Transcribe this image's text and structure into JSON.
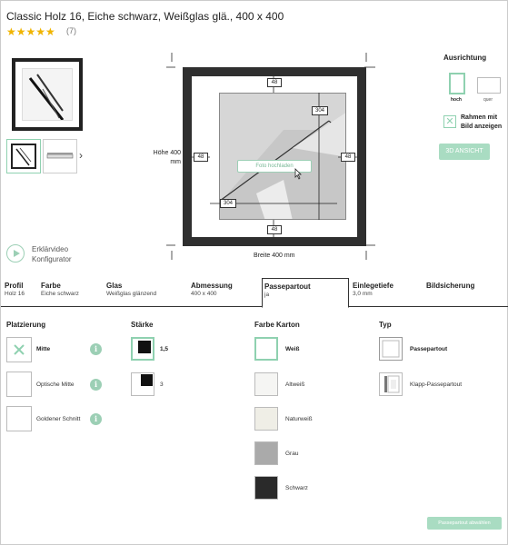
{
  "product": {
    "title": "Classic Holz 16, Eiche schwarz, Weißglas glä., 400 x 400",
    "stars": "★★★★★",
    "rating_count": "(7)"
  },
  "thumbnails": {
    "next": "›"
  },
  "video": {
    "label_line1": "Erklärvideo",
    "label_line2": "Konfigurator"
  },
  "preview": {
    "upload_label": "Foto hochladen",
    "dim_top": "48",
    "dim_bottom": "48",
    "dim_left": "48",
    "dim_right": "48",
    "dim_inner_h": "304",
    "dim_inner_w": "304",
    "height_label_1": "Höhe 400",
    "height_label_2": "mm",
    "width_label": "Breite 400 mm"
  },
  "orientation": {
    "title": "Ausrichtung",
    "hoch": "hoch",
    "quer": "quer",
    "selected": "hoch"
  },
  "show_frame_image": {
    "label": "Rahmen mit Bild anzeigen",
    "checked": true
  },
  "btn_3d": "3D ANSICHT",
  "tabs": [
    {
      "title": "Profil",
      "value": "Holz 16"
    },
    {
      "title": "Farbe",
      "value": "Eiche schwarz"
    },
    {
      "title": "Glas",
      "value": "Weißglas glänzend"
    },
    {
      "title": "Abmessung",
      "value": "400 x 400"
    },
    {
      "title": "Passepartout",
      "value": "ja"
    },
    {
      "title": "Einlegetiefe",
      "value": "3,0 mm"
    },
    {
      "title": "Bildsicherung",
      "value": ""
    }
  ],
  "active_tab": "Passepartout",
  "placement": {
    "title": "Platzierung",
    "options": [
      "Mitte",
      "Optische Mitte",
      "Goldener Schnitt"
    ],
    "selected": "Mitte"
  },
  "thickness": {
    "title": "Stärke",
    "options": [
      "1,5",
      "3"
    ],
    "selected": "1,5"
  },
  "color": {
    "title": "Farbe Karton",
    "options": [
      {
        "label": "Weiß",
        "hex": "#ffffff"
      },
      {
        "label": "Altweiß",
        "hex": "#f5f5f3"
      },
      {
        "label": "Naturweiß",
        "hex": "#efeee6"
      },
      {
        "label": "Grau",
        "hex": "#aaaaaa"
      },
      {
        "label": "Schwarz",
        "hex": "#2a2a2a"
      }
    ],
    "selected": "Weiß"
  },
  "type": {
    "title": "Typ",
    "options": [
      "Passepartout",
      "Klapp-Passepartout"
    ],
    "selected": "Passepartout"
  },
  "cta": "Passepartout abwählen",
  "colors": {
    "accent": "#8fd1b0",
    "frame": "#2f2f2f"
  }
}
